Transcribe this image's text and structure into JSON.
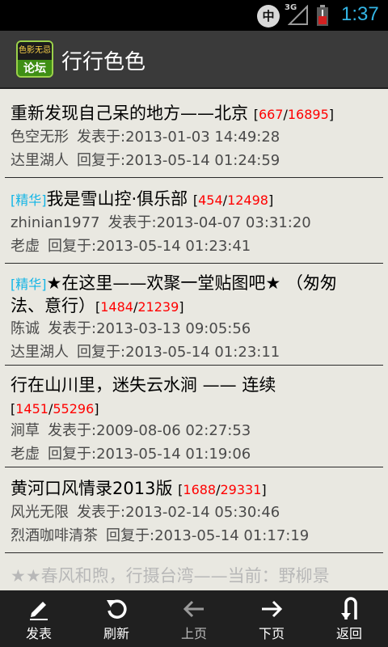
{
  "status_bar": {
    "ime_label": "中",
    "network_label": "3G",
    "time": "1:37"
  },
  "app": {
    "icon_text_top": "色影无忌",
    "icon_text_bottom": "论坛",
    "title": "行行色色"
  },
  "threads": [
    {
      "elite": "",
      "title": "重新发现自己呆的地方——北京",
      "title_line2": "",
      "replies": "667",
      "views": "16895",
      "author": "色空无形",
      "posted": "发表于:2013-01-03 14:49:28",
      "last_replier": "达里湖人",
      "replied": "回复于:2013-05-14 01:24:59"
    },
    {
      "elite": "[精华]",
      "title": "我是雪山控·俱乐部",
      "title_line2": "",
      "replies": "454",
      "views": "12498",
      "author": "zhinian1977",
      "posted": "发表于:2013-04-07 03:31:20",
      "last_replier": "老虚",
      "replied": "回复于:2013-05-14 01:23:41"
    },
    {
      "elite": "[精华]",
      "title": "★在这里——欢聚一堂贴图吧★ （匆匆",
      "title_line2": "法、意行）",
      "replies": "1484",
      "views": "21239",
      "author": "陈诚",
      "posted": "发表于:2013-03-13 09:05:56",
      "last_replier": "达里湖人",
      "replied": "回复于:2013-05-14 01:23:11"
    },
    {
      "elite": "",
      "title": "行在山川里，迷失云水涧 —— 连续",
      "title_line2": "",
      "replies": "1451",
      "views": "55296",
      "author": "涧草",
      "posted": "发表于:2009-08-06 02:27:53",
      "last_replier": "老虚",
      "replied": "回复于:2013-05-14 01:19:06"
    },
    {
      "elite": "",
      "title": "黄河口风情录2013版",
      "title_line2": "",
      "replies": "1688",
      "views": "29331",
      "author": "风光无限",
      "posted": "发表于:2013-02-14 05:30:46",
      "last_replier": "烈酒咖啡清茶",
      "replied": "回复于:2013-05-14 01:17:19"
    }
  ],
  "partial_thread_title": "★★春风和煦，行摄台湾——当前：野柳景",
  "toolbar": {
    "post": "发表",
    "refresh": "刷新",
    "prev": "上页",
    "next": "下页",
    "back": "返回"
  },
  "colors": {
    "status_time": "#33b5e5",
    "elite_tag": "#12b5e6",
    "count_red": "#ff0000"
  }
}
